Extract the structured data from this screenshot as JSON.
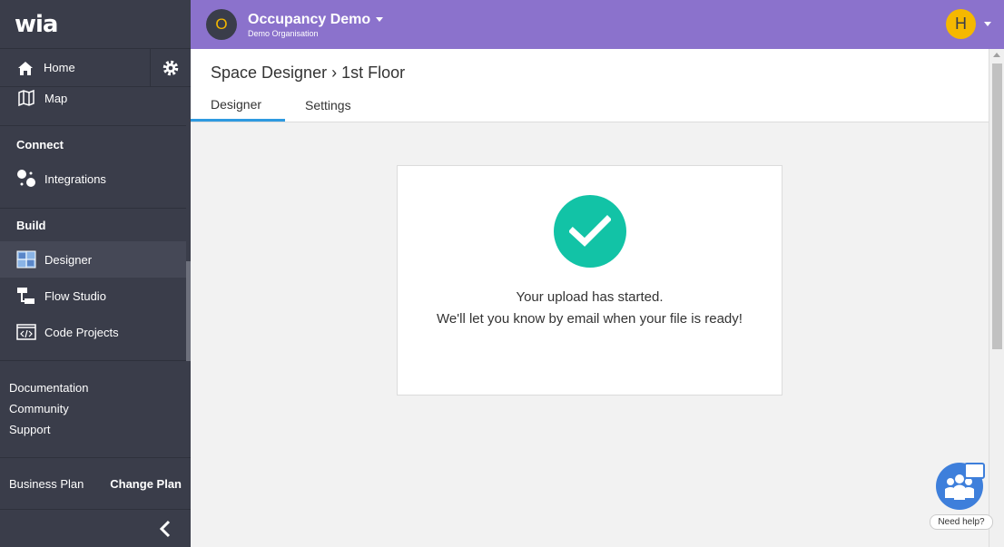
{
  "sidebar": {
    "logo": "wia",
    "home": "Home",
    "map": "Map",
    "connect_title": "Connect",
    "integrations": "Integrations",
    "build_title": "Build",
    "designer": "Designer",
    "flow_studio": "Flow Studio",
    "code_projects": "Code Projects",
    "links": [
      "Documentation",
      "Community",
      "Support"
    ],
    "plan": "Business Plan",
    "change_plan": "Change Plan"
  },
  "header": {
    "org_initial": "O",
    "org_name": "Occupancy Demo",
    "org_sub": "Demo Organisation",
    "user_initial": "H"
  },
  "page": {
    "breadcrumb": "Space Designer › 1st Floor",
    "tabs": [
      "Designer",
      "Settings"
    ],
    "active_tab": "Designer"
  },
  "card": {
    "line1": "Your upload has started.",
    "line2": "We'll let you know by email when your file is ready!"
  },
  "help": {
    "label": "Need help?"
  },
  "colors": {
    "sidebar": "#3a3d4a",
    "header": "#8b72cc",
    "success": "#12c3a6",
    "accent": "#f5b800",
    "tab_underline": "#2e9ae0"
  }
}
